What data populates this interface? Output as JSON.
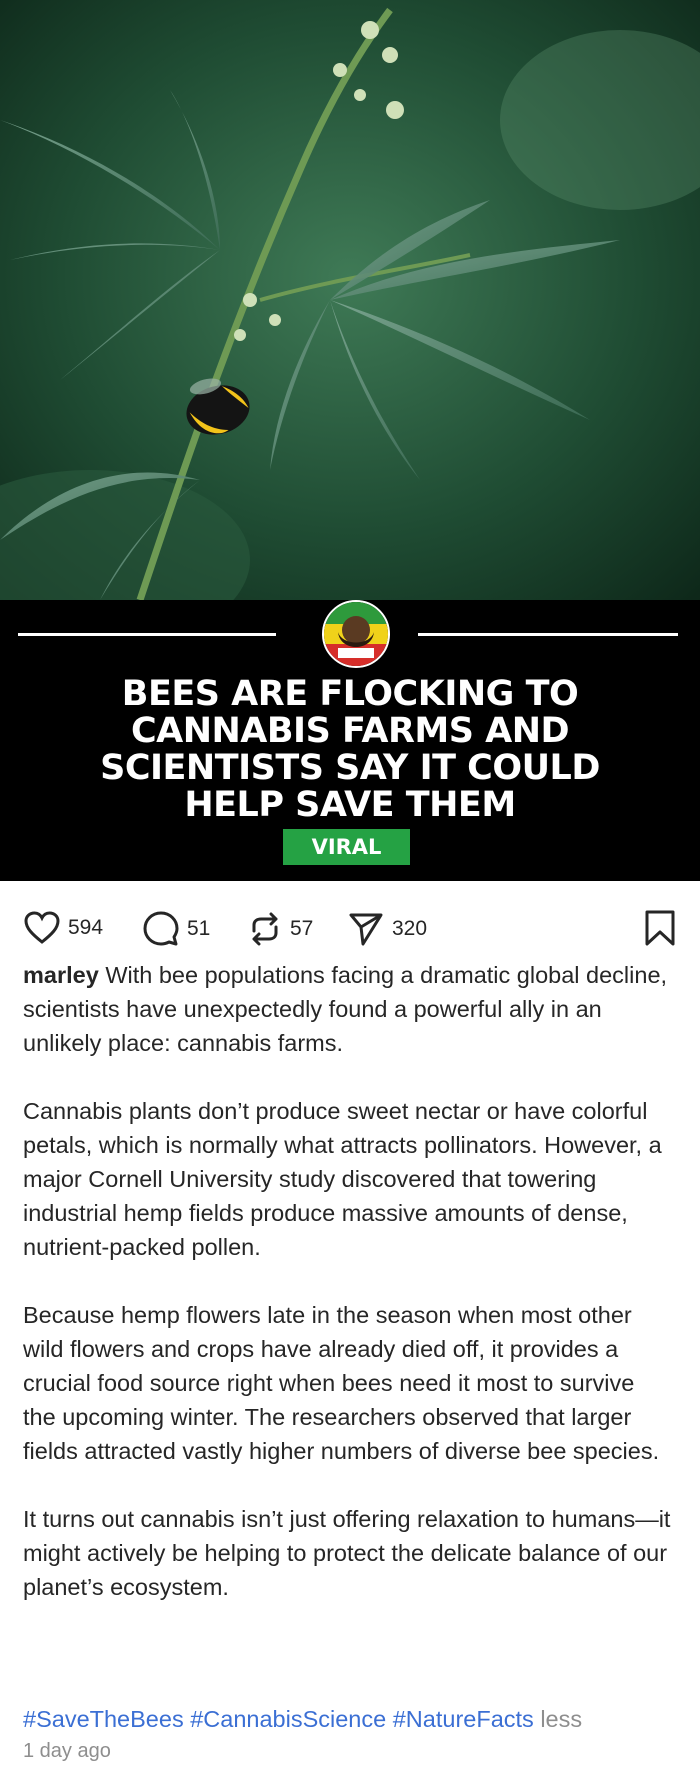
{
  "post": {
    "headline_lines": [
      "BEES ARE FLOCKING TO",
      "CANNABIS FARMS AND",
      "SCIENTISTS SAY IT COULD",
      "HELP SAVE THEM"
    ],
    "badge": "VIRAL",
    "logo_text": "MARLEY"
  },
  "actions": {
    "likes": "594",
    "comments": "51",
    "reposts": "57",
    "shares": "320"
  },
  "caption": {
    "username": "marley",
    "paragraphs": [
      "With bee populations facing a dramatic global decline, scientists have unexpectedly found a powerful ally in an unlikely place: cannabis farms.",
      "Cannabis plants don’t produce sweet nectar or have colorful petals, which is normally what attracts pollinators. However, a major Cornell University study discovered that towering industrial hemp fields produce massive amounts of dense, nutrient-packed pollen.",
      "Because hemp flowers late in the season when most other wild flowers and crops have already died off, it provides a crucial food source right when bees need it most to survive the upcoming winter. The researchers observed that larger fields attracted vastly higher numbers of diverse bee species.",
      "It turns out cannabis isn’t just offering relaxation to humans—it might actively be helping to protect the delicate balance of our planet’s ecosystem."
    ],
    "hashtags": [
      "#SaveTheBees",
      "#CannabisScience",
      "#NatureFacts"
    ],
    "less_label": "less",
    "timestamp": "1 day ago"
  },
  "colors": {
    "badge_green": "#25a244",
    "hashtag_blue": "#3b6fd4",
    "muted_gray": "#8e8e8e"
  }
}
